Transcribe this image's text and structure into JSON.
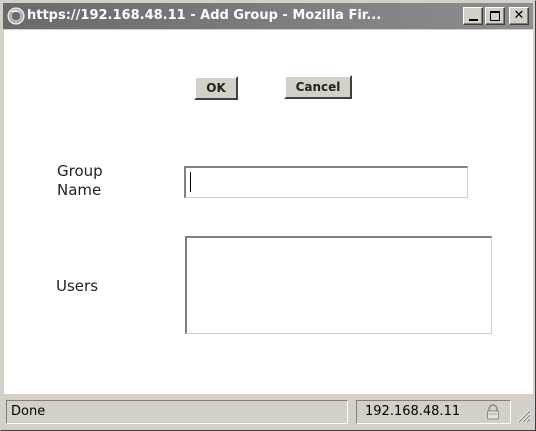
{
  "window": {
    "title": "https://192.168.48.11 - Add Group - Mozilla Fir...",
    "icon": "firefox-icon",
    "controls": {
      "minimize": "minimize-icon",
      "maximize": "maximize-icon",
      "close": "close-icon"
    }
  },
  "form": {
    "ok_label": "OK",
    "cancel_label": "Cancel",
    "group_name_label": "Group Name",
    "group_name_value": "",
    "users_label": "Users",
    "users_value": ""
  },
  "statusbar": {
    "status_text": "Done",
    "host": "192.168.48.11",
    "lock_icon": "lock-icon",
    "grip_icon": "resize-grip-icon"
  }
}
